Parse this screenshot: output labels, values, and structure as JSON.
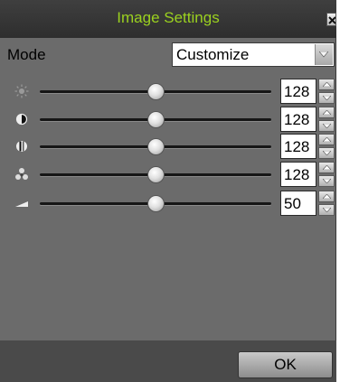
{
  "dialog": {
    "title": "Image Settings",
    "ok_label": "OK"
  },
  "mode": {
    "label": "Mode",
    "value": "Customize"
  },
  "sliders": [
    {
      "icon": "brightness-icon",
      "value": "128",
      "level": 0.5
    },
    {
      "icon": "contrast-icon",
      "value": "128",
      "level": 0.5
    },
    {
      "icon": "saturation-icon",
      "value": "128",
      "level": 0.5
    },
    {
      "icon": "hue-icon",
      "value": "128",
      "level": 0.5
    },
    {
      "icon": "sharpness-icon",
      "value": "50",
      "level": 0.5
    }
  ],
  "colors": {
    "title_text": "#9bd11f",
    "panel": "#6b6b6b",
    "footer": "#4a4a4a"
  }
}
